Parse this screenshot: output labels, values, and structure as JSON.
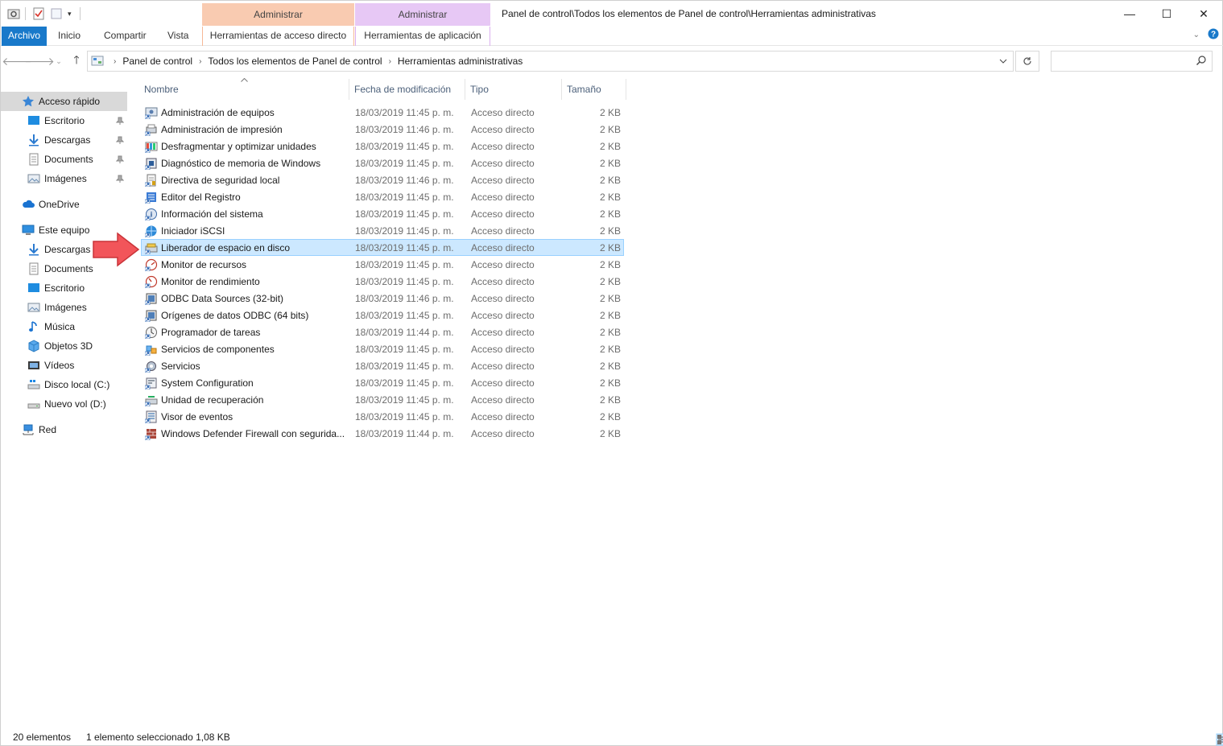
{
  "window": {
    "title": "Panel de control\\Todos los elementos de Panel de control\\Herramientas administrativas",
    "context_tab_1": "Administrar",
    "context_tab_2": "Administrar",
    "minimize": "—",
    "maximize": "☐",
    "close": "✕"
  },
  "ribbon": {
    "file": "Archivo",
    "home": "Inicio",
    "share": "Compartir",
    "view": "Vista",
    "shortcut_tools": "Herramientas de acceso directo",
    "app_tools": "Herramientas de aplicación"
  },
  "address": {
    "crumbs": [
      "Panel de control",
      "Todos los elementos de Panel de control",
      "Herramientas administrativas"
    ],
    "search_placeholder": ""
  },
  "nav": {
    "quick_access": "Acceso rápido",
    "qa_items": [
      "Escritorio",
      "Descargas",
      "Documents",
      "Imágenes"
    ],
    "onedrive": "OneDrive",
    "this_pc": "Este equipo",
    "pc_items": [
      "Descargas",
      "Documents",
      "Escritorio",
      "Imágenes",
      "Música",
      "Objetos 3D",
      "Vídeos",
      "Disco local (C:)",
      "Nuevo vol (D:)"
    ],
    "network": "Red"
  },
  "columns": {
    "name": "Nombre",
    "date": "Fecha de modificación",
    "type": "Tipo",
    "size": "Tamaño"
  },
  "files": [
    {
      "name": "Administración de equipos",
      "date": "18/03/2019 11:45 p. m.",
      "type": "Acceso directo",
      "size": "2 KB"
    },
    {
      "name": "Administración de impresión",
      "date": "18/03/2019 11:46 p. m.",
      "type": "Acceso directo",
      "size": "2 KB"
    },
    {
      "name": "Desfragmentar y optimizar unidades",
      "date": "18/03/2019 11:45 p. m.",
      "type": "Acceso directo",
      "size": "2 KB"
    },
    {
      "name": "Diagnóstico de memoria de Windows",
      "date": "18/03/2019 11:45 p. m.",
      "type": "Acceso directo",
      "size": "2 KB"
    },
    {
      "name": "Directiva de seguridad local",
      "date": "18/03/2019 11:46 p. m.",
      "type": "Acceso directo",
      "size": "2 KB"
    },
    {
      "name": "Editor del Registro",
      "date": "18/03/2019 11:45 p. m.",
      "type": "Acceso directo",
      "size": "2 KB"
    },
    {
      "name": "Información del sistema",
      "date": "18/03/2019 11:45 p. m.",
      "type": "Acceso directo",
      "size": "2 KB"
    },
    {
      "name": "Iniciador iSCSI",
      "date": "18/03/2019 11:45 p. m.",
      "type": "Acceso directo",
      "size": "2 KB"
    },
    {
      "name": "Liberador de espacio en disco",
      "date": "18/03/2019 11:45 p. m.",
      "type": "Acceso directo",
      "size": "2 KB"
    },
    {
      "name": "Monitor de recursos",
      "date": "18/03/2019 11:45 p. m.",
      "type": "Acceso directo",
      "size": "2 KB"
    },
    {
      "name": "Monitor de rendimiento",
      "date": "18/03/2019 11:45 p. m.",
      "type": "Acceso directo",
      "size": "2 KB"
    },
    {
      "name": "ODBC Data Sources (32-bit)",
      "date": "18/03/2019 11:46 p. m.",
      "type": "Acceso directo",
      "size": "2 KB"
    },
    {
      "name": "Orígenes de datos ODBC (64 bits)",
      "date": "18/03/2019 11:45 p. m.",
      "type": "Acceso directo",
      "size": "2 KB"
    },
    {
      "name": "Programador de tareas",
      "date": "18/03/2019 11:44 p. m.",
      "type": "Acceso directo",
      "size": "2 KB"
    },
    {
      "name": "Servicios de componentes",
      "date": "18/03/2019 11:45 p. m.",
      "type": "Acceso directo",
      "size": "2 KB"
    },
    {
      "name": "Servicios",
      "date": "18/03/2019 11:45 p. m.",
      "type": "Acceso directo",
      "size": "2 KB"
    },
    {
      "name": "System Configuration",
      "date": "18/03/2019 11:45 p. m.",
      "type": "Acceso directo",
      "size": "2 KB"
    },
    {
      "name": "Unidad de recuperación",
      "date": "18/03/2019 11:45 p. m.",
      "type": "Acceso directo",
      "size": "2 KB"
    },
    {
      "name": "Visor de eventos",
      "date": "18/03/2019 11:45 p. m.",
      "type": "Acceso directo",
      "size": "2 KB"
    },
    {
      "name": "Windows Defender Firewall con segurida...",
      "date": "18/03/2019 11:44 p. m.",
      "type": "Acceso directo",
      "size": "2 KB"
    }
  ],
  "selected_index": 8,
  "status": {
    "count": "20 elementos",
    "selection": "1 elemento seleccionado  1,08 KB"
  },
  "colors": {
    "accent": "#1979ca",
    "selection_bg": "#cce8ff",
    "selection_border": "#99d1ff",
    "annotation_arrow": "#f2555a"
  }
}
